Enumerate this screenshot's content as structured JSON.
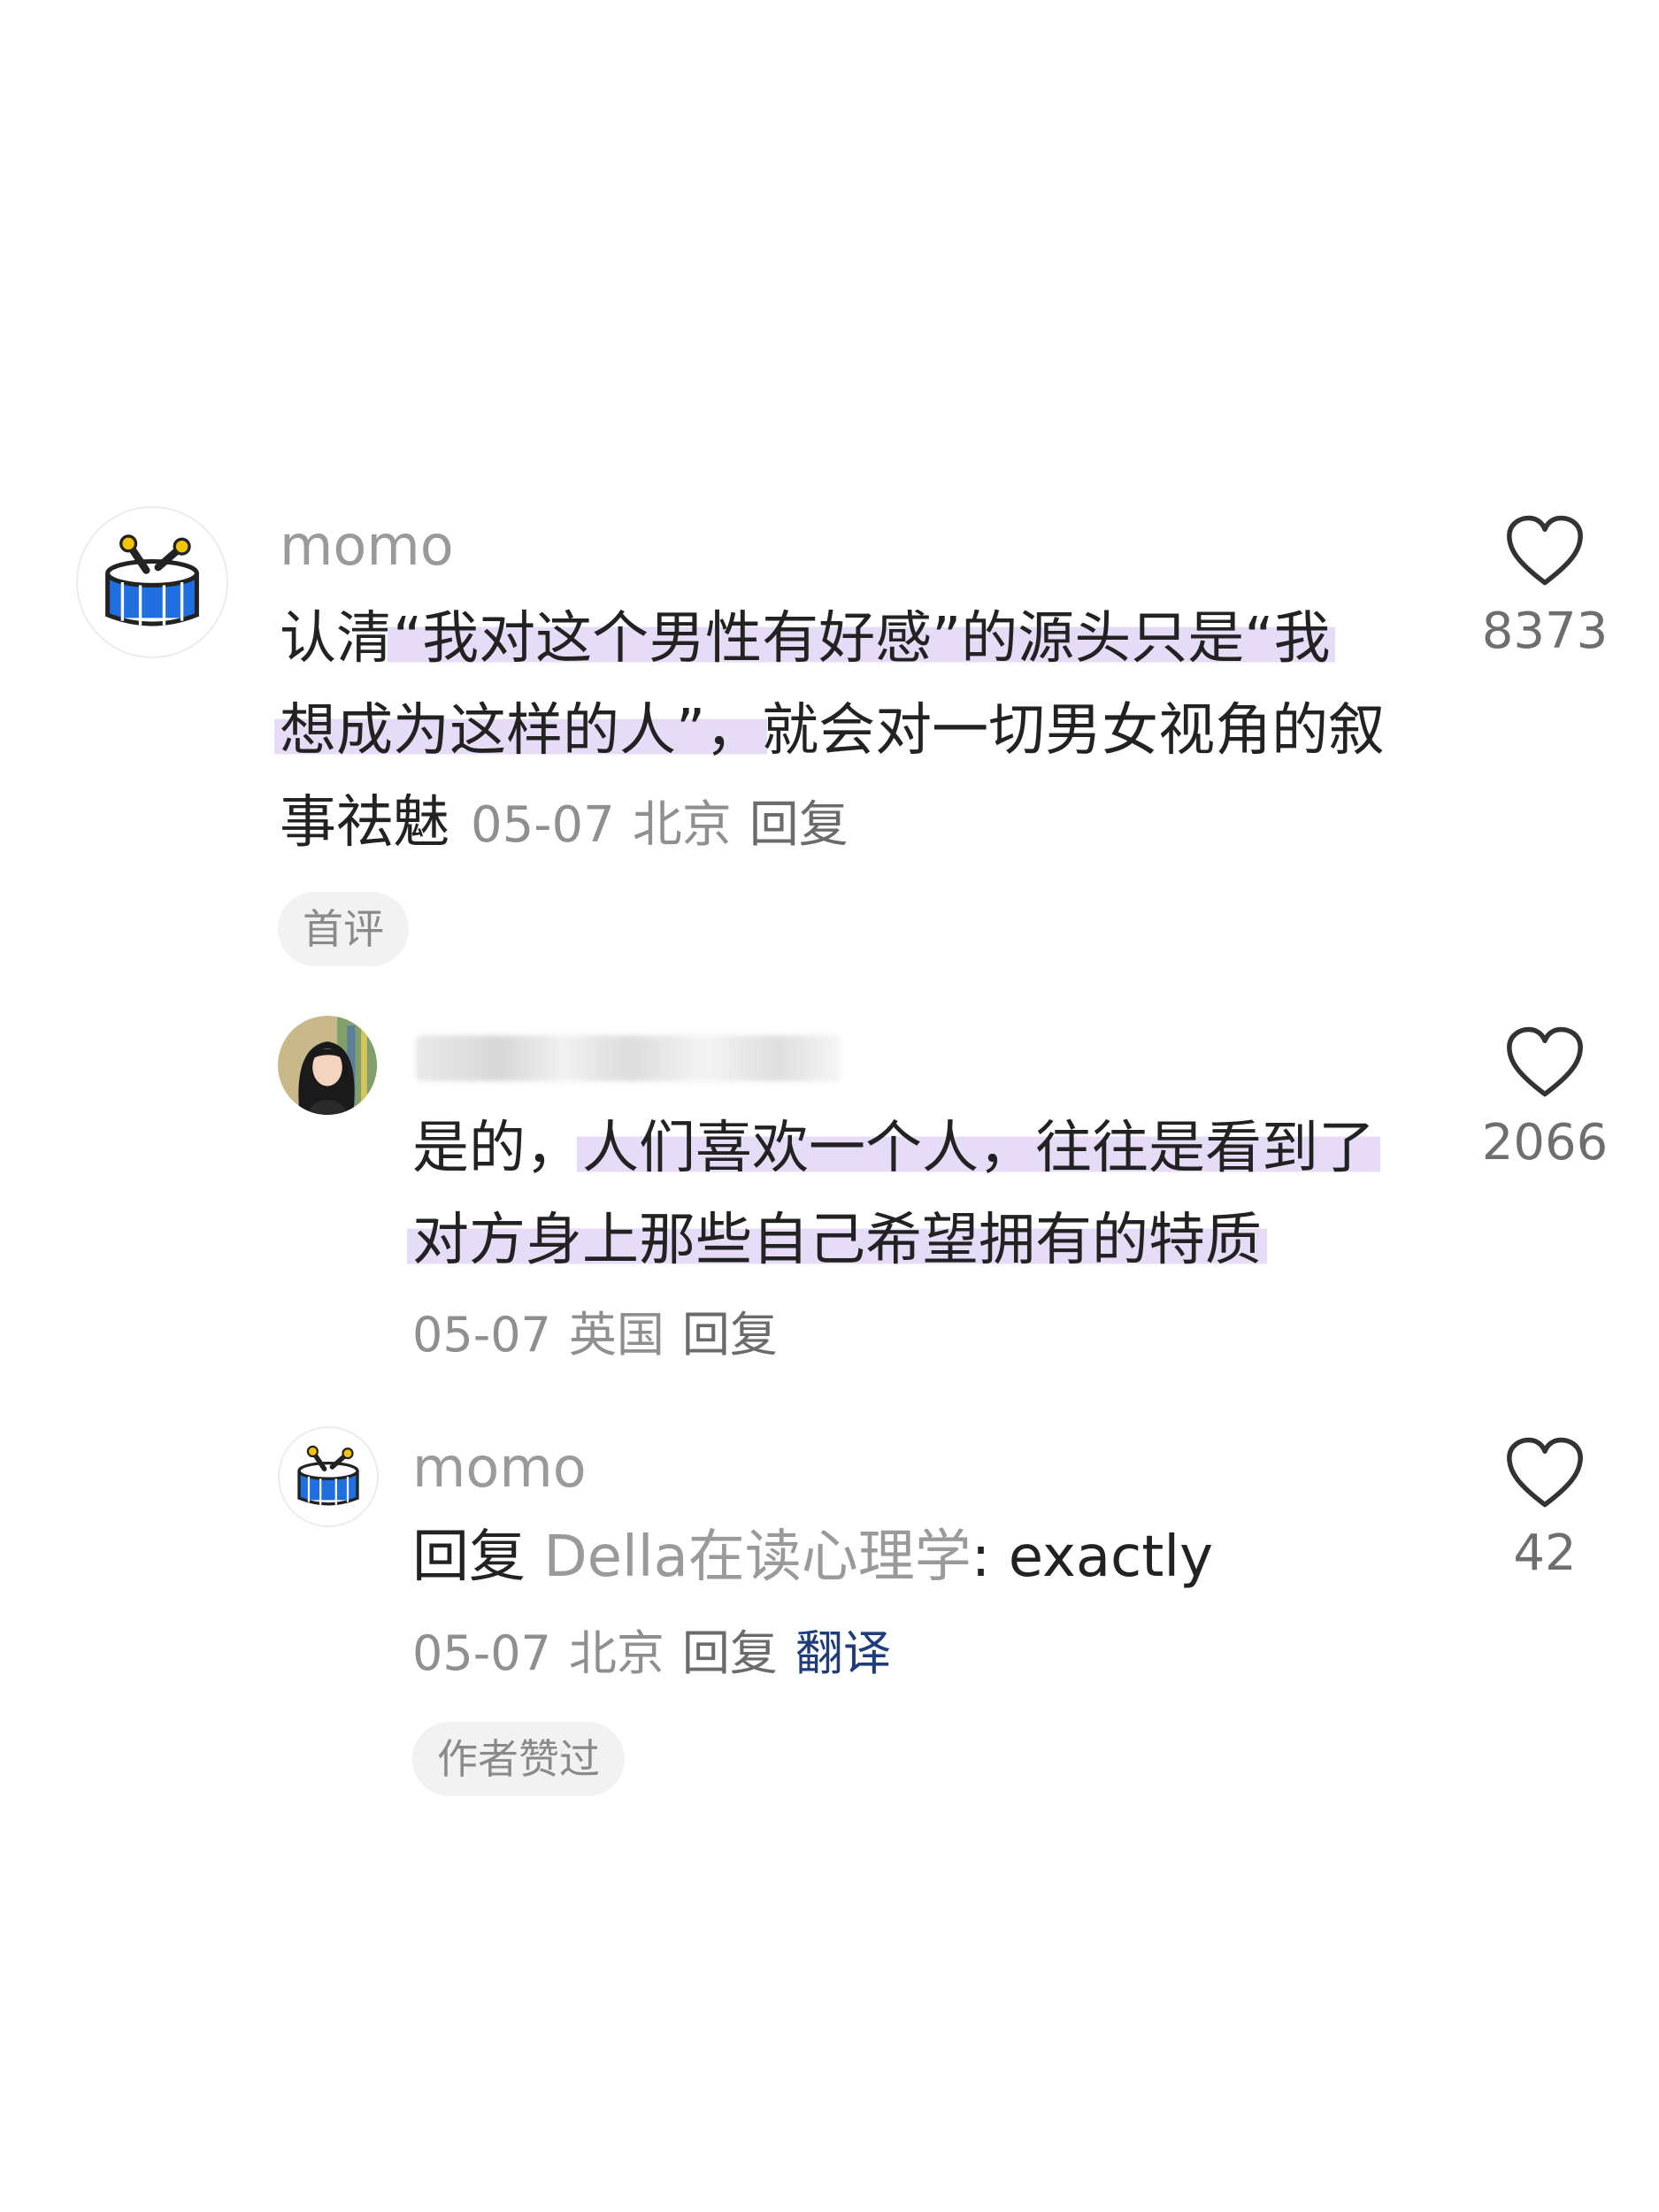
{
  "comments": [
    {
      "username": "momo",
      "text_before": "认清",
      "text_highlight_1": "“我对这个男性有好感”的源头只是“我",
      "text_highlight_2": "想成为这样的人”，",
      "text_after_line2": "就会对一切男女视角的叙",
      "text_line3": "事祛魅",
      "date": "05-07",
      "location": "北京",
      "reply_label": "回复",
      "tag": "首评",
      "likes": "8373"
    },
    {
      "username": "",
      "text_before": "是的，",
      "text_highlight_1": "人们喜欢一个人，往往是看到了",
      "text_highlight_2": "对方身上那些自己希望拥有的特质",
      "date": "05-07",
      "location": "英国",
      "reply_label": "回复",
      "likes": "2066"
    },
    {
      "username": "momo",
      "reply_prefix": "回复",
      "reply_to": "Della在读心理学",
      "text": ": exactly",
      "date": "05-07",
      "location": "北京",
      "reply_label": "回复",
      "translate_label": "翻译",
      "tag": "作者赞过",
      "likes": "42"
    }
  ],
  "colors": {
    "highlight": "#e6dcf8",
    "drum_blue": "#1f6fe0",
    "drum_yellow": "#f5c400",
    "translate_link": "#1f3c7a"
  }
}
